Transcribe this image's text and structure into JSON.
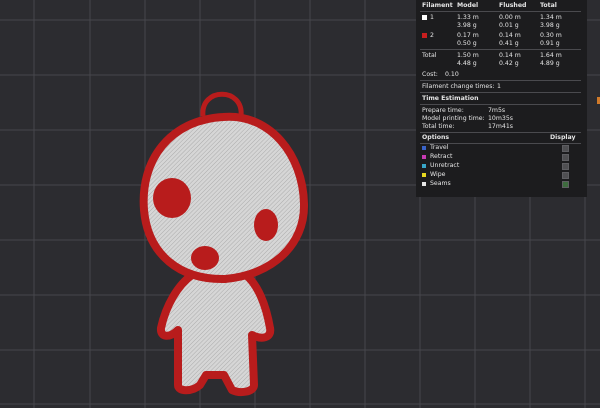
{
  "filament_table": {
    "headers": {
      "filament": "Filament",
      "model": "Model",
      "flushed": "Flushed",
      "total": "Total"
    },
    "rows": [
      {
        "id": "1",
        "color": "#ffffff",
        "model_m": "1.33 m",
        "model_g": "3.98 g",
        "flushed_m": "0.00 m",
        "flushed_g": "0.01 g",
        "total_m": "1.34 m",
        "total_g": "3.98 g"
      },
      {
        "id": "2",
        "color": "#c81e1e",
        "model_m": "0.17 m",
        "model_g": "0.50 g",
        "flushed_m": "0.14 m",
        "flushed_g": "0.41 g",
        "total_m": "0.30 m",
        "total_g": "0.91 g"
      }
    ],
    "total": {
      "label": "Total",
      "model_m": "1.50 m",
      "model_g": "4.48 g",
      "flushed_m": "0.14 m",
      "flushed_g": "0.42 g",
      "total_m": "1.64 m",
      "total_g": "4.89 g"
    },
    "cost_label": "Cost:",
    "cost_value": "0.10",
    "change_label": "Filament change times:",
    "change_value": "1"
  },
  "time_estimation": {
    "title": "Time Estimation",
    "prepare_label": "Prepare time:",
    "prepare_value": "7m5s",
    "model_label": "Model printing time:",
    "model_value": "10m35s",
    "total_label": "Total time:",
    "total_value": "17m41s"
  },
  "options": {
    "title": "Options",
    "display_title": "Display",
    "items": [
      {
        "label": "Travel",
        "color": "#3a64c8",
        "checked": false
      },
      {
        "label": "Retract",
        "color": "#c83ab4",
        "checked": false
      },
      {
        "label": "Unretract",
        "color": "#38a6c8",
        "checked": false
      },
      {
        "label": "Wipe",
        "color": "#e8d820",
        "checked": false
      },
      {
        "label": "Seams",
        "color": "#e6e6e6",
        "checked": true
      }
    ]
  },
  "colors": {
    "background": "#2c2c30",
    "grid": "#46464c",
    "model_outline": "#b81c1c",
    "model_fill": "#cfcfcf"
  }
}
